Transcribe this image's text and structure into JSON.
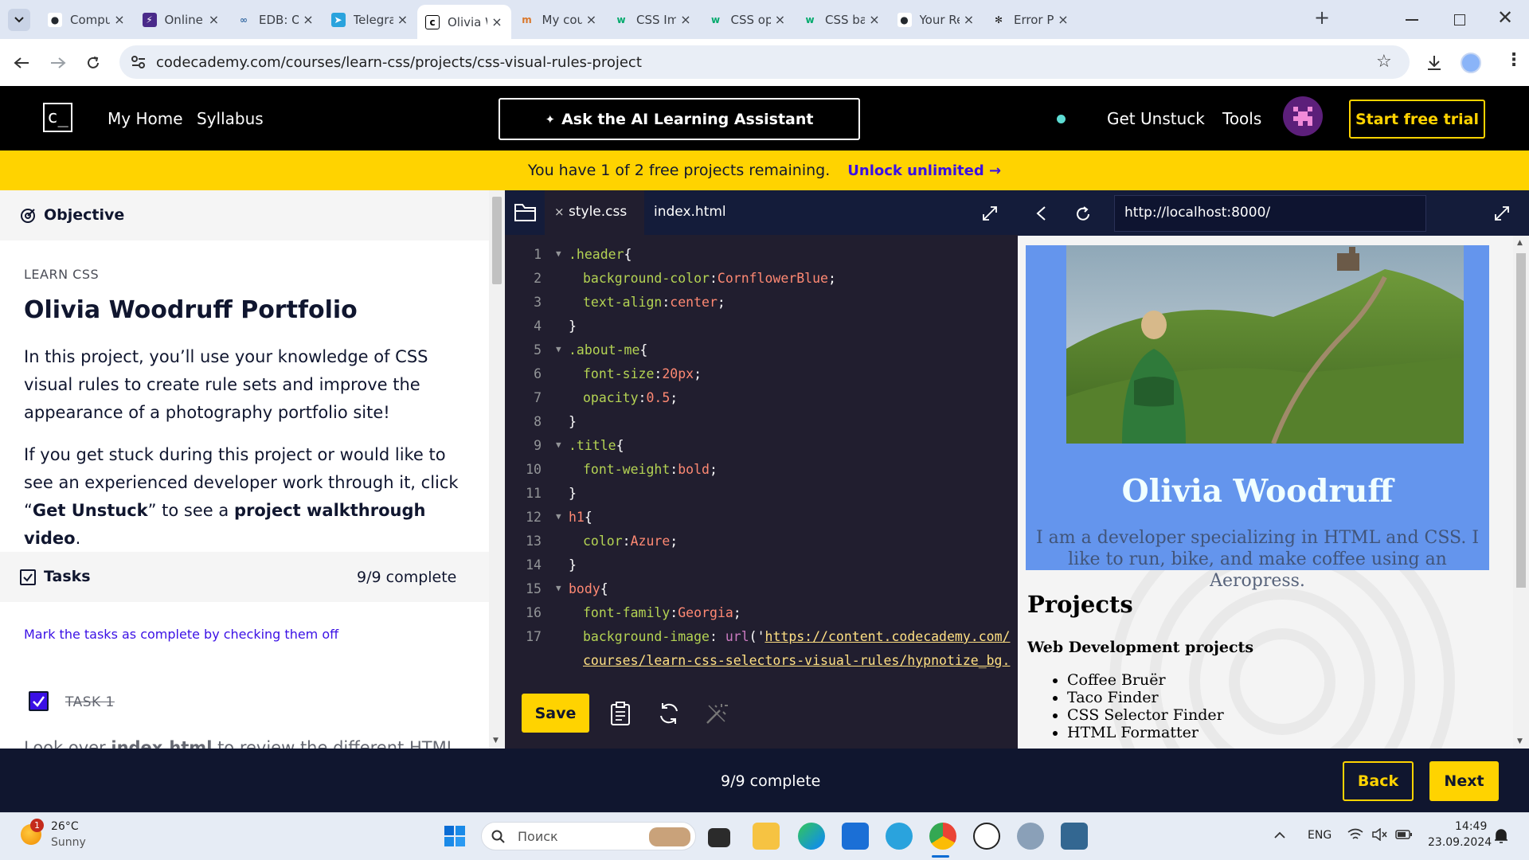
{
  "browser": {
    "tabs": [
      {
        "title": "Comput",
        "icon": "github-icon"
      },
      {
        "title": "Online F",
        "icon": "bolt-icon"
      },
      {
        "title": "EDB: Op",
        "icon": "link-icon"
      },
      {
        "title": "Telegran",
        "icon": "telegram-icon"
      },
      {
        "title": "Olivia W",
        "icon": "codecademy-icon",
        "active": true
      },
      {
        "title": "My cour",
        "icon": "course-icon"
      },
      {
        "title": "CSS Ima",
        "icon": "w3schools-icon"
      },
      {
        "title": "CSS opa",
        "icon": "w3schools-icon"
      },
      {
        "title": "CSS bac",
        "icon": "w3schools-icon"
      },
      {
        "title": "Your Re",
        "icon": "github-icon"
      },
      {
        "title": "Error Pa",
        "icon": "openai-icon"
      }
    ],
    "url": "codecademy.com/courses/learn-css/projects/css-visual-rules-project"
  },
  "header": {
    "logo": "c_",
    "nav": [
      "My Home",
      "Syllabus"
    ],
    "ask_ai": "Ask the AI Learning Assistant",
    "get_unstuck": "Get Unstuck",
    "tools": "Tools",
    "start_trial": "Start free trial"
  },
  "banner": {
    "text": "You have 1 of 2 free projects remaining.",
    "link": "Unlock unlimited",
    "arrow": "→"
  },
  "left_panel": {
    "objective_label": "Objective",
    "course_label": "LEARN CSS",
    "title": "Olivia Woodruff Portfolio",
    "para1": "In this project, you’ll use your knowledge of CSS visual rules to create rule sets and improve the appearance of a photography portfolio site!",
    "para2_a": "If you get stuck during this project or would like to see an experienced developer work through it, click “",
    "para2_b": "Get Unstuck",
    "para2_c": "” to see a ",
    "para2_d": "project walkthrough video",
    "para2_e": ".",
    "tasks_label": "Tasks",
    "tasks_count": "9/9 complete",
    "mark_hint": "Mark the tasks as complete by checking them off",
    "task1": "TASK 1",
    "task1_text_a": "Look over ",
    "task1_text_b": "index.html",
    "task1_text_c": " to review the different HTML"
  },
  "editor": {
    "tabs": [
      "style.css",
      "index.html"
    ],
    "active_tab": "style.css",
    "save_label": "Save",
    "lines": [
      {
        "n": "1",
        "fold": true,
        "parts": [
          [
            "sel",
            ".header"
          ],
          [
            "pun",
            "{"
          ]
        ]
      },
      {
        "n": "2",
        "indent": 1,
        "parts": [
          [
            "prop",
            "background-color"
          ],
          [
            "pun",
            ":"
          ],
          [
            "val",
            "CornflowerBlue"
          ],
          [
            "pun",
            ";"
          ]
        ]
      },
      {
        "n": "3",
        "indent": 1,
        "parts": [
          [
            "prop",
            "text-align"
          ],
          [
            "pun",
            ":"
          ],
          [
            "val",
            "center"
          ],
          [
            "pun",
            ";"
          ]
        ]
      },
      {
        "n": "4",
        "parts": [
          [
            "pun",
            "}"
          ]
        ]
      },
      {
        "n": "5",
        "fold": true,
        "parts": [
          [
            "sel",
            ".about-me"
          ],
          [
            "pun",
            "{"
          ]
        ]
      },
      {
        "n": "6",
        "indent": 1,
        "parts": [
          [
            "prop",
            "font-size"
          ],
          [
            "pun",
            ":"
          ],
          [
            "val",
            "20px"
          ],
          [
            "pun",
            ";"
          ]
        ]
      },
      {
        "n": "7",
        "indent": 1,
        "parts": [
          [
            "prop",
            "opacity"
          ],
          [
            "pun",
            ":"
          ],
          [
            "val",
            "0.5"
          ],
          [
            "pun",
            ";"
          ]
        ]
      },
      {
        "n": "8",
        "parts": [
          [
            "pun",
            "}"
          ]
        ]
      },
      {
        "n": "9",
        "fold": true,
        "parts": [
          [
            "sel",
            ".title"
          ],
          [
            "pun",
            "{"
          ]
        ]
      },
      {
        "n": "10",
        "indent": 1,
        "parts": [
          [
            "prop",
            "font-weight"
          ],
          [
            "pun",
            ":"
          ],
          [
            "val",
            "bold"
          ],
          [
            "pun",
            ";"
          ]
        ]
      },
      {
        "n": "11",
        "parts": [
          [
            "pun",
            "}"
          ]
        ]
      },
      {
        "n": "12",
        "fold": true,
        "parts": [
          [
            "val",
            "h1"
          ],
          [
            "pun",
            "{"
          ]
        ]
      },
      {
        "n": "13",
        "indent": 1,
        "parts": [
          [
            "prop",
            "color"
          ],
          [
            "pun",
            ":"
          ],
          [
            "val",
            "Azure"
          ],
          [
            "pun",
            ";"
          ]
        ]
      },
      {
        "n": "14",
        "parts": [
          [
            "pun",
            "}"
          ]
        ]
      },
      {
        "n": "15",
        "fold": true,
        "parts": [
          [
            "val",
            "body"
          ],
          [
            "pun",
            "{"
          ]
        ]
      },
      {
        "n": "16",
        "indent": 1,
        "parts": [
          [
            "prop",
            "font-family"
          ],
          [
            "pun",
            ":"
          ],
          [
            "val",
            "Georgia"
          ],
          [
            "pun",
            ";"
          ]
        ]
      },
      {
        "n": "17",
        "indent": 1,
        "parts": [
          [
            "prop",
            "background-image"
          ],
          [
            "pun",
            ": "
          ],
          [
            "fn",
            "url"
          ],
          [
            "pun",
            "('"
          ],
          [
            "str",
            "https://content.codecademy.com/"
          ]
        ]
      },
      {
        "n": "",
        "indent": 1,
        "parts": [
          [
            "str",
            "courses/learn-css-selectors-visual-rules/hypnotize_bg."
          ]
        ]
      }
    ]
  },
  "preview": {
    "url": "http://localhost:8000/",
    "name": "Olivia Woodruff",
    "about": "I am a developer specializing in HTML and CSS. I like to run, bike, and make coffee using an Aeropress.",
    "projects_heading": "Projects",
    "subheading": "Web Development projects",
    "items": [
      "Coffee Bruër",
      "Taco Finder",
      "CSS Selector Finder",
      "HTML Formatter"
    ]
  },
  "footer": {
    "progress": "9/9 complete",
    "back": "Back",
    "next": "Next"
  },
  "taskbar": {
    "weather_temp": "26°C",
    "weather_text": "Sunny",
    "weather_badge": "1",
    "search_placeholder": "Поиск",
    "lang": "ENG",
    "time": "14:49",
    "date": "23.09.2024"
  },
  "colors": {
    "brand_yellow": "#ffd300",
    "brand_navy": "#10162f",
    "brand_purple": "#3a10e5",
    "preview_header": "#6495ed",
    "editor_bg": "#211e2f"
  }
}
